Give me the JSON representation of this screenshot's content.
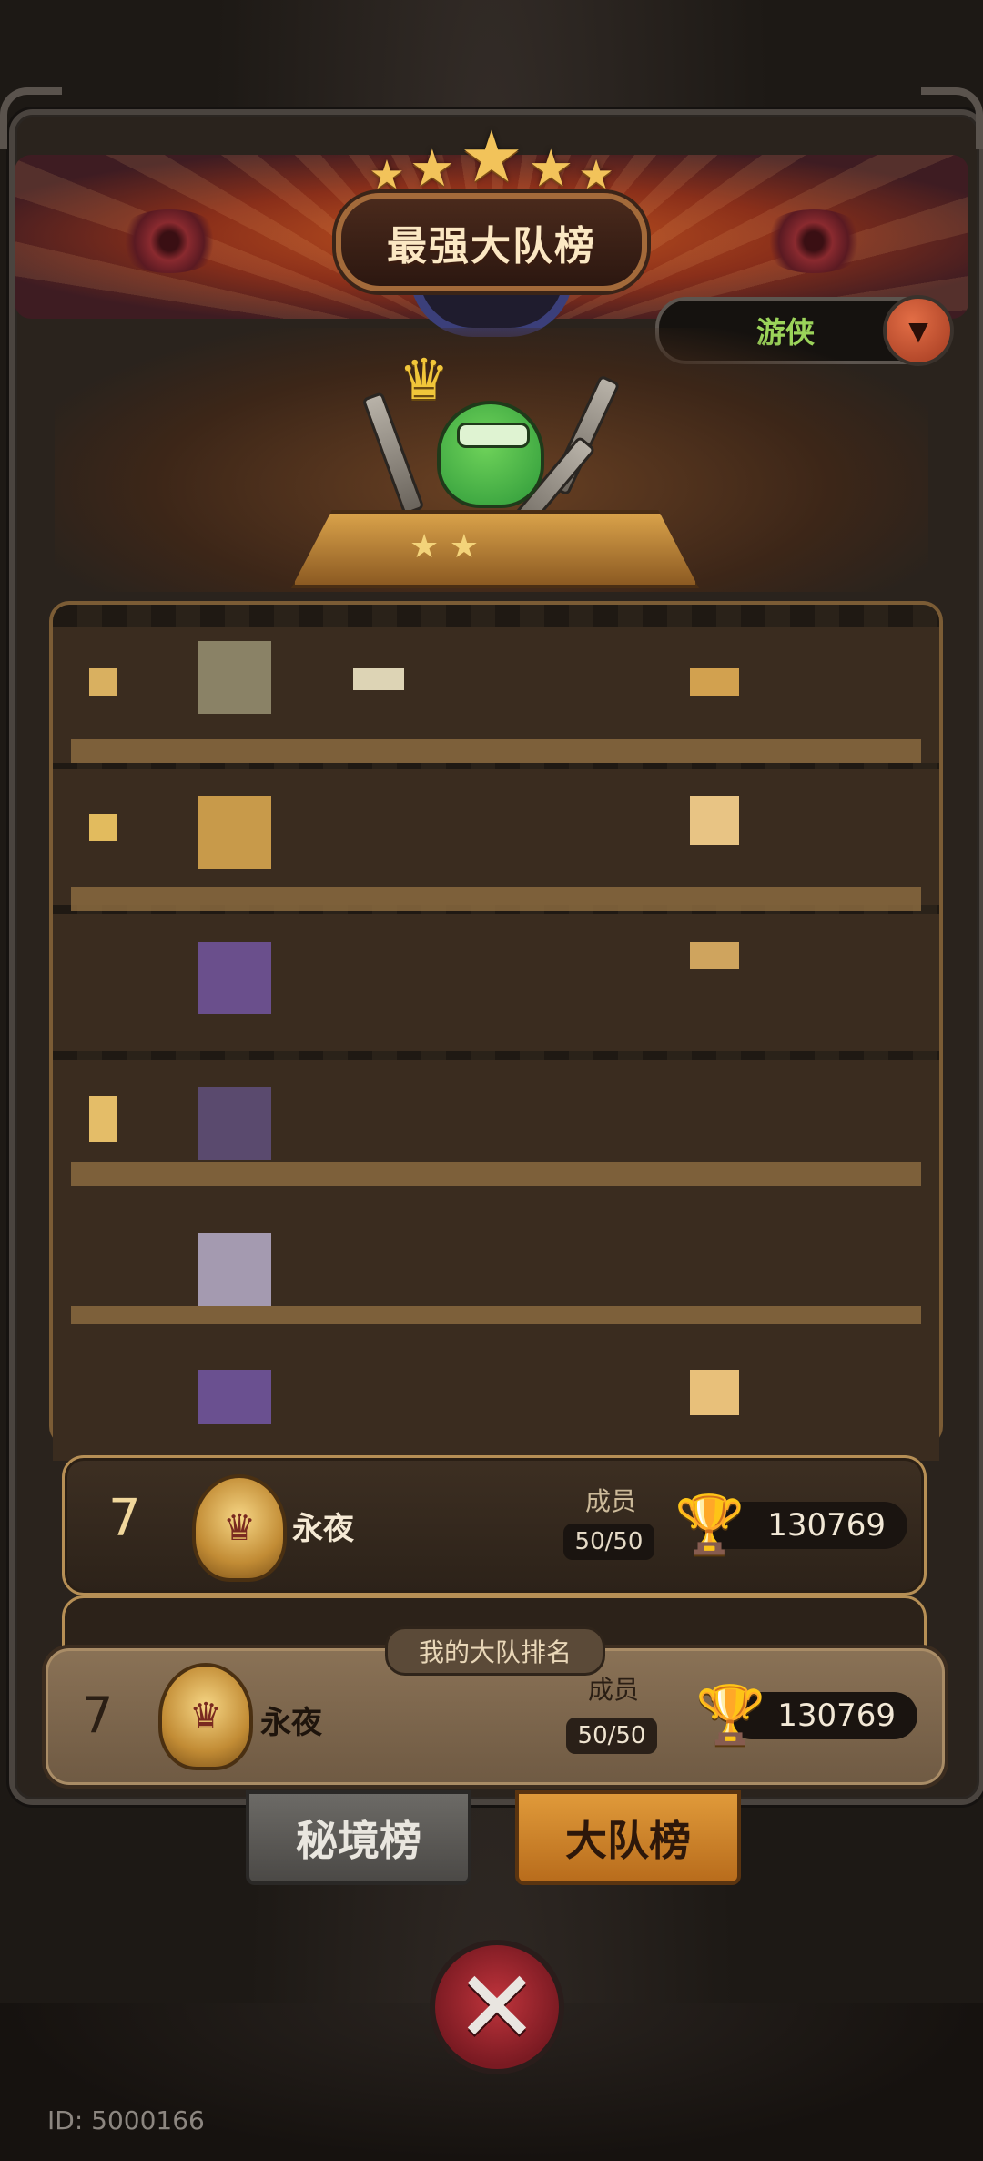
{
  "header": {
    "title": "最强大队榜",
    "class_filter": "游侠"
  },
  "rows": [
    {
      "rank": "7",
      "name": "永夜",
      "members_label": "成员",
      "members": "50/50",
      "score": "130769"
    }
  ],
  "my_rank": {
    "tag": "我的大队排名",
    "rank": "7",
    "name": "永夜",
    "members_label": "成员",
    "members": "50/50",
    "score": "130769"
  },
  "tabs": [
    {
      "label": "秘境榜",
      "active": false
    },
    {
      "label": "大队榜",
      "active": true
    }
  ],
  "footer": {
    "player_id": "ID: 5000166"
  },
  "colors": {
    "accent_gold": "#e2aa3a",
    "filter_text": "#9bd35a",
    "active_tab": "#e09a3a",
    "close_red": "#c0343c"
  },
  "icons": [
    "star-icon",
    "crown-icon",
    "chevron-down-icon",
    "trophy-icon",
    "emblem-icon",
    "close-icon"
  ]
}
